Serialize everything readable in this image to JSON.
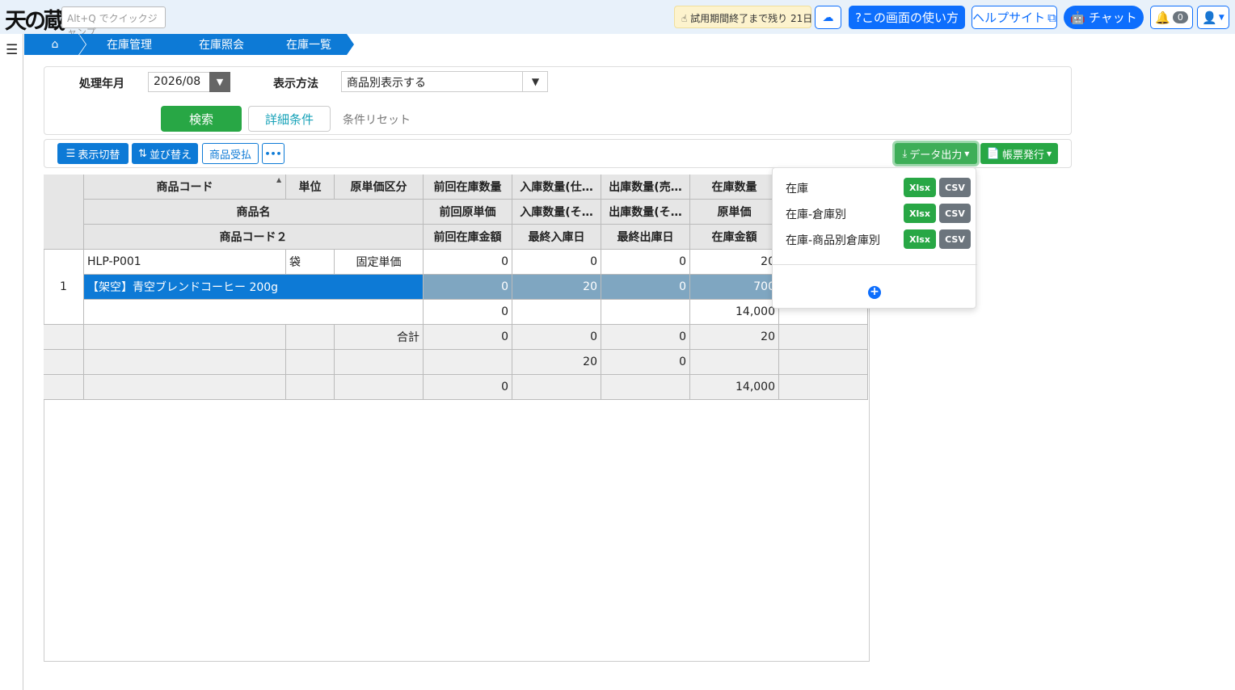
{
  "header": {
    "logo": "天の蔵",
    "quickjump_placeholder": "Alt+Q でクイックジャンプ",
    "trial_text": "試用期間終了まで残り 21日",
    "howto_label": "?この画面の使い方",
    "helpsite_label": "ヘルプサイト",
    "chat_label": "チャット",
    "notification_count": "0"
  },
  "breadcrumb": [
    "在庫管理",
    "在庫照会",
    "在庫一覧"
  ],
  "search": {
    "period_label": "処理年月",
    "period_value": "2026/08",
    "display_label": "表示方法",
    "display_value": "商品別表示する",
    "search_button": "検索",
    "detail_button": "詳細条件",
    "reset_link": "条件リセット"
  },
  "toolbar": {
    "view_toggle": "表示切替",
    "sort": "並び替え",
    "product_ledger": "商品受払",
    "more": "•••",
    "data_export": "データ出力",
    "report_issue": "帳票発行"
  },
  "grid": {
    "headers": {
      "row1": [
        "商品コード",
        "単位",
        "原単価区分",
        "前回在庫数量",
        "入庫数量(仕…",
        "出庫数量(売…",
        "在庫数量"
      ],
      "row2": [
        "商品名",
        "前回原単価",
        "入庫数量(そ…",
        "出庫数量(そ…",
        "原単価"
      ],
      "row3": [
        "商品コード２",
        "前回在庫金額",
        "最終入庫日",
        "最終出庫日",
        "在庫金額"
      ]
    },
    "rows": [
      {
        "no": "1",
        "code": "HLP-P001",
        "unit": "袋",
        "cost_type": "固定単価",
        "prev_qty": "0",
        "in_qty_purchase": "0",
        "out_qty_sales": "0",
        "stock_qty": "20",
        "name": "【架空】青空ブレンドコーヒー 200g",
        "prev_unit_cost": "0",
        "in_qty_other": "20",
        "out_qty_other": "0",
        "unit_cost": "700",
        "code2": "",
        "prev_amount": "0",
        "last_in_date": "",
        "last_out_date": "",
        "stock_amount": "14,000"
      }
    ],
    "footer": {
      "label": "合計",
      "r1": [
        "0",
        "0",
        "0",
        "20"
      ],
      "r2": [
        "",
        "20",
        "0",
        ""
      ],
      "r3": [
        "0",
        "",
        "",
        "14,000"
      ]
    }
  },
  "export_menu": {
    "items": [
      {
        "label": "在庫",
        "xlsx": "Xlsx",
        "csv": "CSV"
      },
      {
        "label": "在庫-倉庫別",
        "xlsx": "Xlsx",
        "csv": "CSV"
      },
      {
        "label": "在庫-商品別倉庫別",
        "xlsx": "Xlsx",
        "csv": "CSV"
      }
    ]
  },
  "colors": {
    "primary": "#0d7ad6",
    "success": "#28a745",
    "selected_row": "#0d7ad6",
    "selected_num": "#7fa6c1"
  }
}
